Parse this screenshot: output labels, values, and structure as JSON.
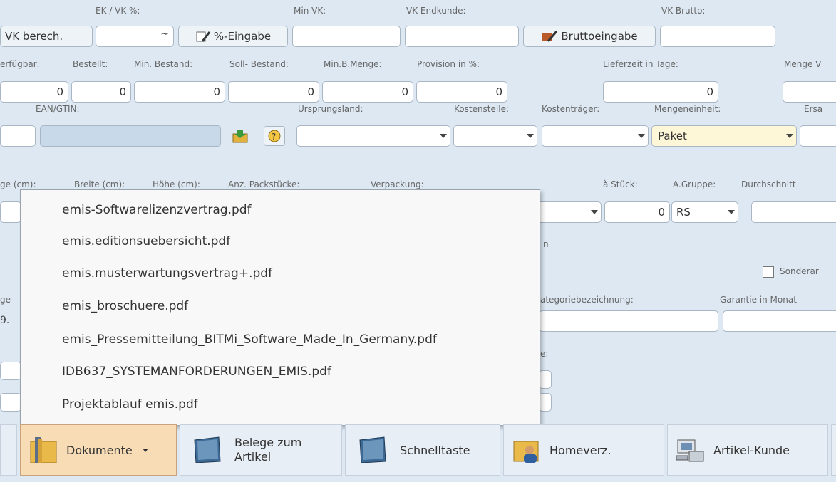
{
  "labels": {
    "ek_vk": "EK / VK %:",
    "min_vk": "Min VK:",
    "vk_endkunde": "VK Endkunde:",
    "vk_brutto": "VK Brutto:",
    "verfuegbar": "erfügbar:",
    "bestellt": "Bestellt:",
    "min_bestand": "Min. Bestand:",
    "soll_bestand": "Soll- Bestand:",
    "min_b_menge": "Min.B.Menge:",
    "provision": "Provision in %:",
    "lieferzeit": "Lieferzeit in Tage:",
    "menge_v": "Menge V",
    "ean_gtin": "EAN/GTIN:",
    "ursprungsland": "Ursprungsland:",
    "kostenstelle": "Kostenstelle:",
    "kostentraeger": "Kostenträger:",
    "mengeneinheit": "Mengeneinheit:",
    "ersa": "Ersa",
    "laenge_cm": "ge (cm):",
    "breite_cm": "Breite (cm):",
    "hoehe_cm": "Höhe (cm):",
    "anz_packstuecke": "Anz. Packstücke:",
    "verpackung": "Verpackung:",
    "a_stueck": "à Stück:",
    "a_gruppe": "A.Gruppe:",
    "durchschnitt": "Durchschnitt",
    "n": "n",
    "sonderar": "Sonderar",
    "ge_left": "ge",
    "kategoriebezeichnung": "ategoriebezeichnung:",
    "garantie": "Garantie in Monat",
    "e_colon": "e:",
    "nine": "9."
  },
  "buttons": {
    "vk_berech": "VK berech.",
    "prozent_eingabe": "%-Eingabe",
    "bruttoeingabe": "Bruttoeingabe"
  },
  "fields": {
    "verfuegbar": "0",
    "bestellt": "0",
    "min_bestand": "0",
    "soll_bestand": "0",
    "min_b_menge": "0",
    "provision": "0",
    "lieferzeit": "0",
    "mengeneinheit": "Paket",
    "a_stueck": "0",
    "a_gruppe": "RS"
  },
  "menu": {
    "items": [
      "emis-Softwarelizenzvertrag.pdf",
      "emis.editionsuebersicht.pdf",
      "emis.musterwartungsvertrag+.pdf",
      "emis_broschuere.pdf",
      "emis_Pressemitteilung_BITMi_Software_Made_In_Germany.pdf",
      "IDB637_SYSTEMANFORDERUNGEN_EMIS.pdf",
      "Projektablauf emis.pdf"
    ]
  },
  "toolbar": {
    "dokumente": "Dokumente",
    "belege_line1": "Belege zum",
    "belege_line2": "Artikel",
    "schnelltaste": "Schnelltaste",
    "homeverz": "Homeverz.",
    "artikel_kunde": "Artikel-Kunde"
  },
  "icons": {
    "folder": "folder-icon",
    "book": "book-icon",
    "user_folder": "user-folder-icon",
    "computer": "computer-icon",
    "help": "help-icon",
    "import": "import-icon"
  },
  "colors": {
    "background": "#dde8f3",
    "active_tile": "#f7dcb6",
    "highlight_field": "#fdf7d8"
  }
}
